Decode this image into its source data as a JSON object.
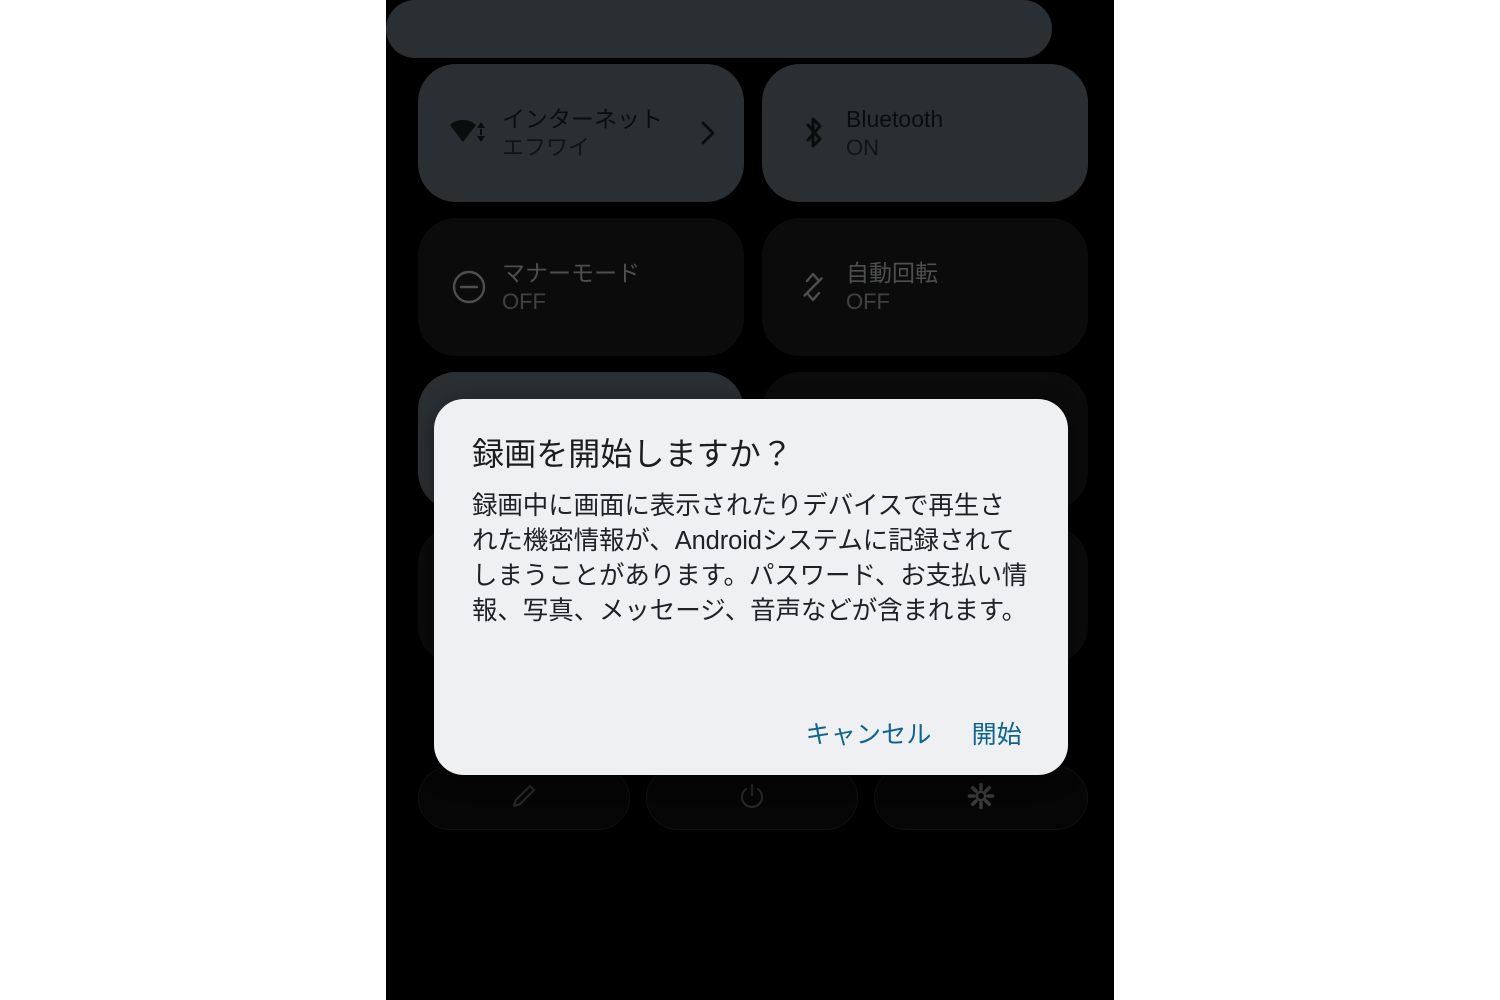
{
  "theme": {
    "panel_background": "#000000",
    "tile_active_background": "#4e585e",
    "tile_inactive_background": "#161616",
    "dialog_background": "#eff0f2",
    "dialog_button_text": "#0c6590",
    "outside_background": "#ffffff"
  },
  "quick_settings": {
    "brightness_slider": {
      "name": "brightness-slider",
      "state": "active"
    },
    "tiles": [
      {
        "icon": "wifi-icon",
        "title": "インターネット",
        "subtitle": "エフワイ",
        "state": "ON",
        "active": true,
        "has_chevron": true
      },
      {
        "icon": "bluetooth-icon",
        "title": "Bluetooth",
        "subtitle": "ON",
        "state": "ON",
        "active": true,
        "has_chevron": false
      },
      {
        "icon": "do-not-disturb-icon",
        "title": "マナーモード",
        "subtitle": "OFF",
        "state": "OFF",
        "active": false,
        "has_chevron": false
      },
      {
        "icon": "auto-rotate-icon",
        "title": "自動回転",
        "subtitle": "OFF",
        "state": "OFF",
        "active": false,
        "has_chevron": false
      },
      {
        "icon": "screen-record-icon",
        "title": "",
        "subtitle": "",
        "state": "ON",
        "active": true,
        "has_chevron": false
      },
      {
        "icon": "tile-icon",
        "title": "",
        "subtitle": "",
        "state": "OFF",
        "active": false,
        "has_chevron": false
      },
      {
        "icon": "tile-icon",
        "title": "",
        "subtitle": "",
        "state": "OFF",
        "active": false,
        "has_chevron": false
      },
      {
        "icon": "tile-icon",
        "title": "",
        "subtitle": "",
        "state": "OFF",
        "active": false,
        "has_chevron": false
      }
    ],
    "footer_buttons": [
      {
        "icon": "pencil-edit-icon",
        "name": "edit-tiles-button"
      },
      {
        "icon": "power-icon",
        "name": "power-button"
      },
      {
        "icon": "gear-settings-icon",
        "name": "settings-button"
      }
    ]
  },
  "dialog": {
    "title": "録画を開始しますか？",
    "message": "録画中に画面に表示されたりデバイスで再生された機密情報が、Androidシステムに記録されてしまうことがあります。パスワード、お支払い情報、写真、メッセージ、音声などが含まれます。",
    "cancel_label": "キャンセル",
    "confirm_label": "開始"
  }
}
